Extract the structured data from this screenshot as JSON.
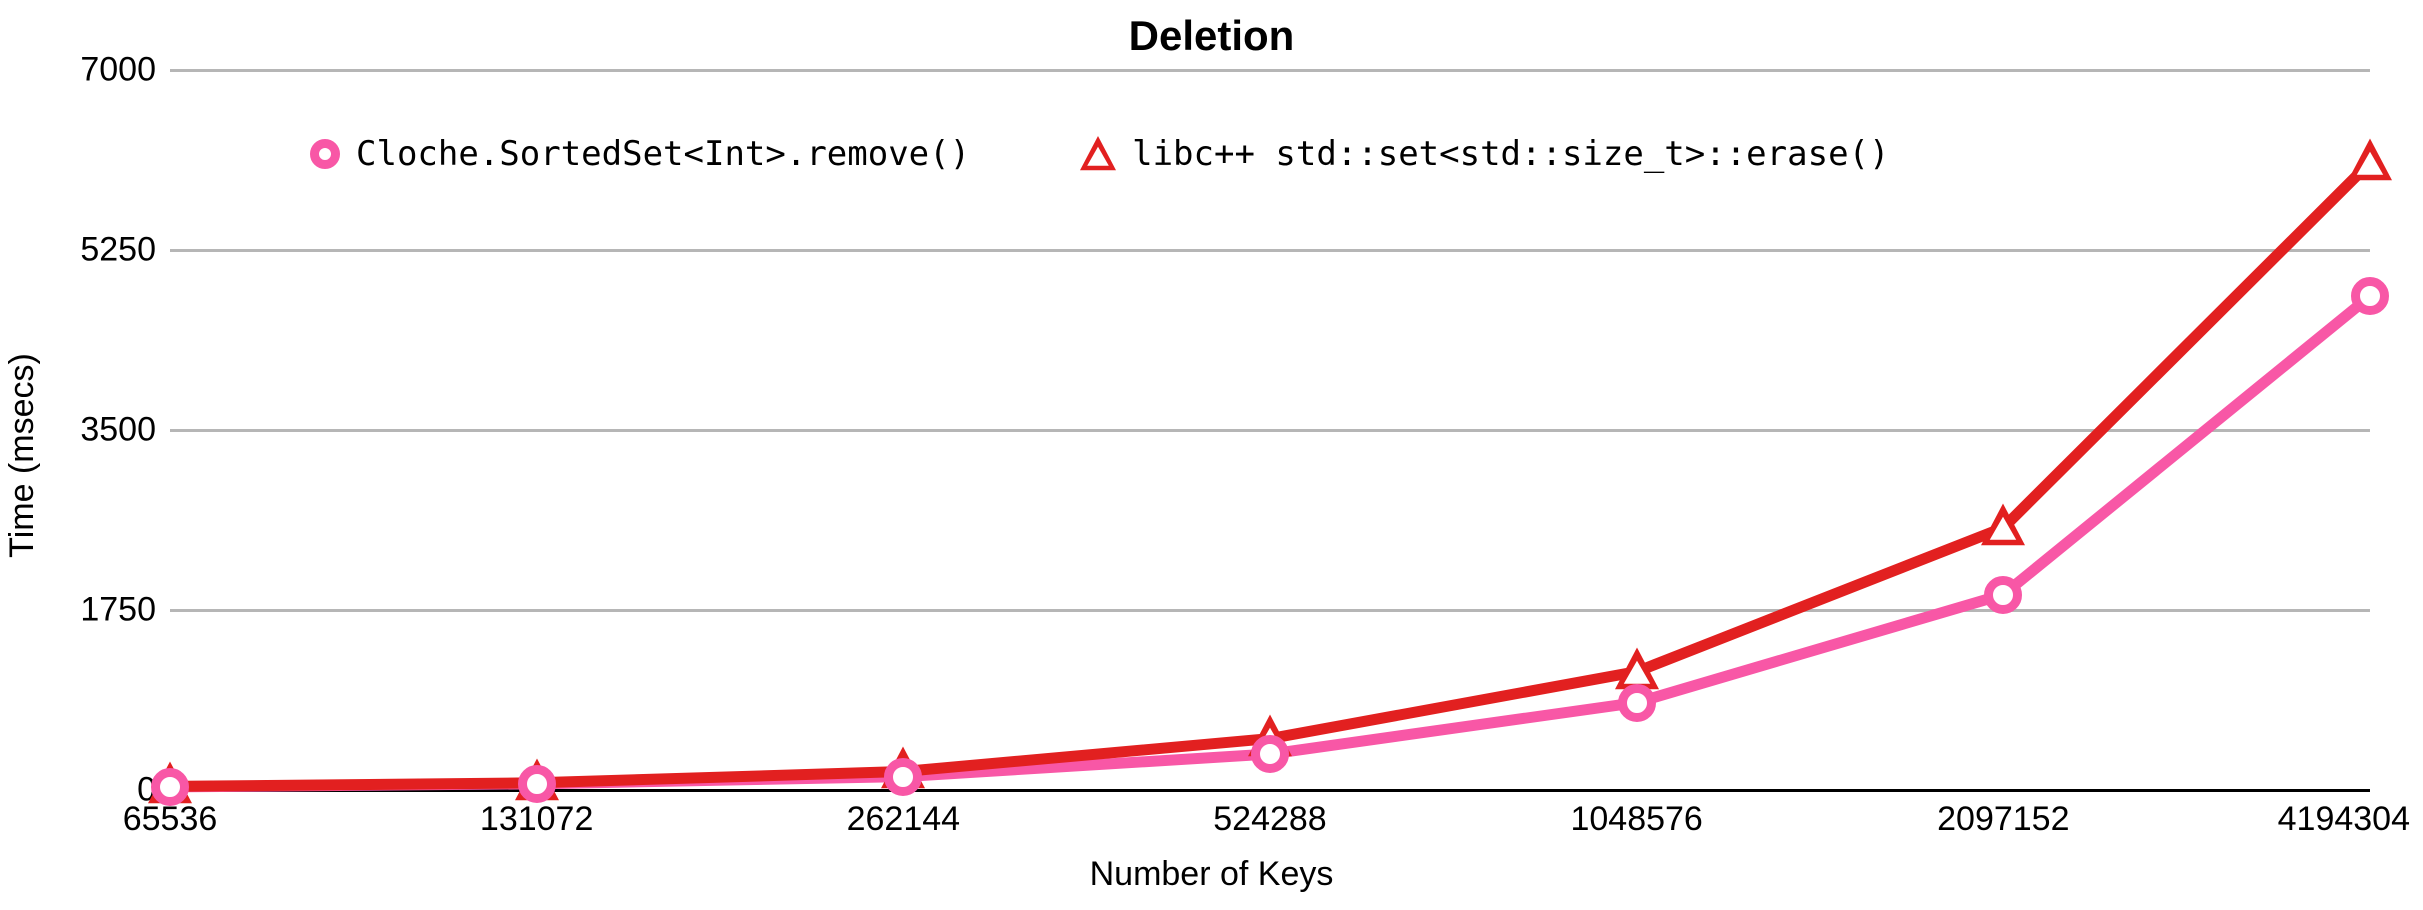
{
  "chart_data": {
    "type": "line",
    "title": "Deletion",
    "xlabel": "Number of Keys",
    "ylabel": "Time (msecs)",
    "ylim": [
      0,
      7000
    ],
    "yticks": [
      0,
      1750,
      3500,
      5250,
      7000
    ],
    "categories": [
      "65536",
      "131072",
      "262144",
      "524288",
      "1048576",
      "2097152",
      "4194304"
    ],
    "series": [
      {
        "name": "Cloche.SortedSet<Int>.remove()",
        "color": "#f857a6",
        "marker": "circle",
        "values": [
          30,
          60,
          130,
          350,
          850,
          1900,
          4800
        ]
      },
      {
        "name": "libc++ std::set<std::size_t>::erase()",
        "color": "#e22020",
        "marker": "triangle",
        "values": [
          35,
          70,
          180,
          500,
          1150,
          2550,
          6100
        ]
      }
    ],
    "legend_position": "top-inside"
  }
}
